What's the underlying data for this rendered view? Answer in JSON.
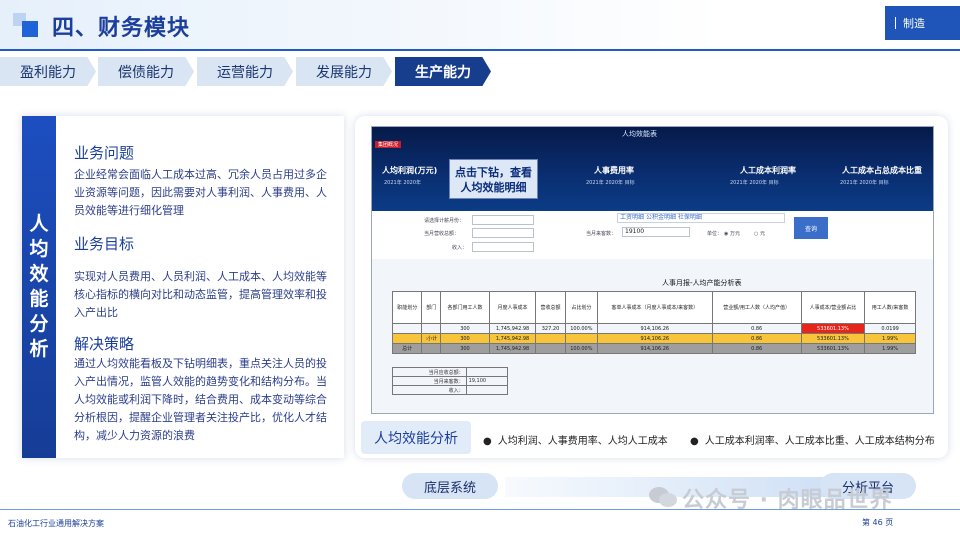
{
  "header": {
    "title": "四、财务模块",
    "tag": "制造"
  },
  "tabs": [
    {
      "label": "盈利能力",
      "active": false
    },
    {
      "label": "偿债能力",
      "active": false
    },
    {
      "label": "运营能力",
      "active": false
    },
    {
      "label": "发展能力",
      "active": false
    },
    {
      "label": "生产能力",
      "active": true
    }
  ],
  "left": {
    "vertical_title": [
      "人",
      "均",
      "效",
      "能",
      "分",
      "析"
    ],
    "sections": [
      {
        "heading": "业务问题",
        "text": "企业经常会面临人工成本过高、冗余人员占用过多企业资源等问题，因此需要对人事利润、人事费用、人员效能等进行细化管理"
      },
      {
        "heading": "业务目标",
        "text": "实现对人员费用、人员利润、人工成本、人均效能等核心指标的横向对比和动态监管，提高管理效率和投入产出比"
      },
      {
        "heading": "解决策略",
        "text": "通过人均效能看板及下钻明细表，重点关注人员的投入产出情况，监管人效能的趋势变化和结构分布。当人均效能或利润下降时，结合费用、成本变动等综合分析根因，提醒企业管理者关注投产比，优化人才结构，减少人力资源的浪费"
      }
    ]
  },
  "screenshot": {
    "dash_title": "人均效能表",
    "dash_tag": "集团概况",
    "kpis": [
      {
        "label": "人均利润(万元)",
        "sub": "2021年    2020年"
      },
      {
        "label": "人事费用率",
        "sub": "2021年    2020年    目标"
      },
      {
        "label": "人工成本利润率",
        "sub": "2021年    2020年    目标"
      },
      {
        "label": "人工成本占总成本比重",
        "sub": "2021年    2020年    目标"
      }
    ],
    "callout": "点击下钻，查看人均效能明细",
    "filters": {
      "period_label": "请选择计薪月份：",
      "revenue_label": "当月营收总额：",
      "income_label": "收入：",
      "count_label": "当月来客数：",
      "count_value": "19100",
      "unit_label": "单位：",
      "unit_wan": "万元",
      "unit_yuan": "元",
      "query": "查询",
      "tags": [
        "工资明细",
        "公积金明细",
        "社保明细"
      ]
    },
    "table_title": "人事月报-人均产能分析表",
    "headers": [
      "职能划分",
      "部门",
      "各部门用工人数",
      "月度人事成本",
      "营收总额",
      "占比划分",
      "客单人事成本（月度人事成本/来客数）",
      "营业额/用工人数（人均产值）",
      "人事成本/营业额占比",
      "用工人数/来客数"
    ],
    "rows": [
      {
        "style": "",
        "cells": [
          "",
          "",
          "300",
          "1,745,942.98",
          "327.20",
          "100.00%",
          "914,106.26",
          "0.86",
          "533601.13%",
          "0.0199"
        ]
      },
      {
        "style": "yel",
        "cells": [
          "",
          ":小计",
          "300",
          "1,745,942.98",
          "",
          "",
          "914,106.26",
          "0.86",
          "533601.13%",
          "1.99%"
        ]
      },
      {
        "style": "gry",
        "cells": [
          "总计",
          "",
          "300",
          "1,745,942.98",
          "",
          "100.00%",
          "914,106.26",
          "0.86",
          "533601.13%",
          "1.99%"
        ]
      }
    ],
    "mini": [
      [
        "当月应收总额：",
        ""
      ],
      [
        "当月来客数：",
        "19,100"
      ],
      [
        "收入：",
        ""
      ]
    ]
  },
  "bottom": {
    "label": "人均效能分析",
    "bullets": [
      "人均利润、人事费用率、人均人工成本",
      "人工成本利润率、人工成本比重、人工成本结构分布"
    ]
  },
  "flow": {
    "left": "底层系统",
    "right": "分析平台"
  },
  "footer": {
    "left": "石油化工行业通用解决方案",
    "page": "第    46    页",
    "watermark": "公众号 · 肉眼品世界"
  },
  "colors": {
    "primary": "#1c3f9c",
    "active_tab": "#173d8d",
    "tab": "#d9e5f3",
    "highlight": "#f7c43a",
    "alert": "#e7261b"
  }
}
